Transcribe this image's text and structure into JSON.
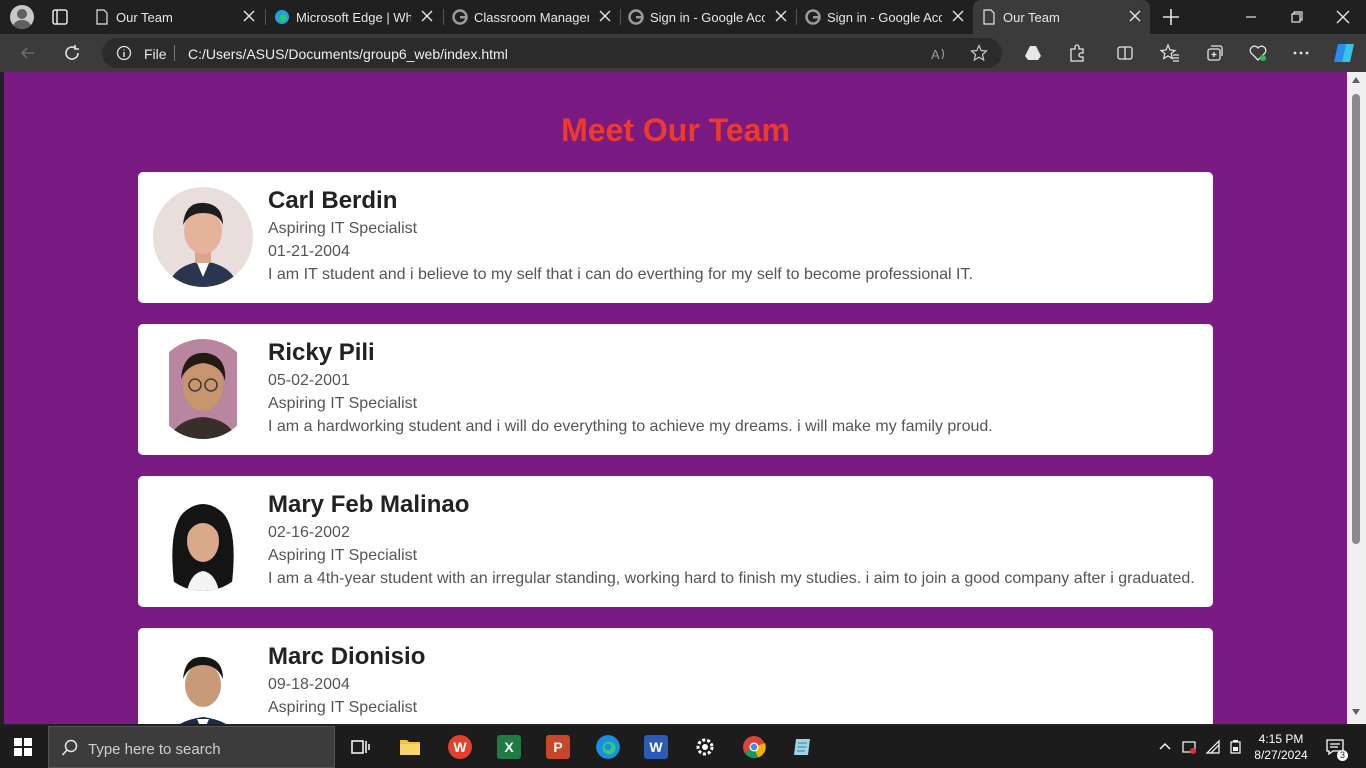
{
  "browser": {
    "tabs": [
      {
        "label": "Our Team"
      },
      {
        "label": "Microsoft Edge | What"
      },
      {
        "label": "Classroom Manageme"
      },
      {
        "label": "Sign in - Google Acco"
      },
      {
        "label": "Sign in - Google Acco"
      },
      {
        "label": "Our Team"
      }
    ],
    "address": {
      "scheme_label": "File",
      "url": "C:/Users/ASUS/Documents/group6_web/index.html"
    }
  },
  "page": {
    "title": "Meet Our Team",
    "members": [
      {
        "name": "Carl Berdin",
        "line1": "Aspiring IT Specialist",
        "line2": "01-21-2004",
        "line3": "I am IT student and i believe to my self that i can do everthing for my self to become professional IT."
      },
      {
        "name": "Ricky Pili",
        "line1": "05-02-2001",
        "line2": "Aspiring IT Specialist",
        "line3": "I am a hardworking student and i will do everything to achieve my dreams. i will make my family proud."
      },
      {
        "name": "Mary Feb Malinao",
        "line1": "02-16-2002",
        "line2": "Aspiring IT Specialist",
        "line3": "I am a 4th-year student with an irregular standing, working hard to finish my studies. i aim to join a good company after i graduated."
      },
      {
        "name": "Marc Dionisio",
        "line1": "09-18-2004",
        "line2": "Aspiring IT Specialist",
        "line3": ""
      }
    ]
  },
  "taskbar": {
    "search_placeholder": "Type here to search",
    "time": "4:15 PM",
    "date": "8/27/2024",
    "notification_count": "3"
  },
  "colors": {
    "page_background": "#7a1b84",
    "title": "#ed3a2a",
    "card": "#ffffff"
  }
}
